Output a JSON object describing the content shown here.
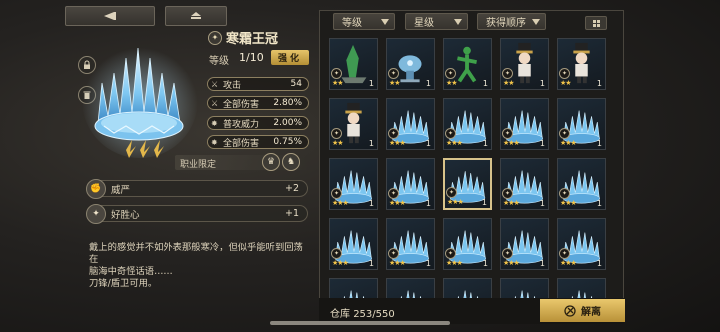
{
  "nav": {
    "back_icon": "back-arrow-icon",
    "menu_icon": "eject-menu-icon"
  },
  "item": {
    "name": "寒霜王冠",
    "level_label": "等级",
    "level_value": "1/10",
    "enhance_label": "强化",
    "stats": [
      {
        "icon": "sword-icon",
        "name": "攻击",
        "value": "54"
      },
      {
        "icon": "sword-icon",
        "name": "全部伤害",
        "value": "2.80%"
      },
      {
        "icon": "sparkle-icon",
        "name": "普攻威力",
        "value": "2.00%"
      },
      {
        "icon": "sparkle-icon",
        "name": "全部伤害",
        "value": "0.75%"
      }
    ],
    "job_label": "职业限定",
    "traits": [
      {
        "icon": "fist-icon",
        "name": "威严",
        "value": "+2"
      },
      {
        "icon": "stars-icon",
        "name": "好胜心",
        "value": "+1"
      }
    ],
    "description": [
      "戴上的感觉并不如外表那般寒冷，但似乎能听到回荡在",
      "脑海中奇怪话语……",
      "刀锋/盾卫可用。"
    ],
    "accent_color": "#d9b75a"
  },
  "inventory": {
    "filters": [
      {
        "label": "等级"
      },
      {
        "label": "星级"
      },
      {
        "label": "获得顺序"
      }
    ],
    "storage_label": "仓库",
    "storage_count": "253/550",
    "dismantle_label": "解离",
    "slots": [
      {
        "art": "green-statue",
        "stars": "★★",
        "count": "1"
      },
      {
        "art": "ice-drone",
        "stars": "★★",
        "count": "1"
      },
      {
        "art": "green-figure",
        "stars": "★★",
        "count": "1"
      },
      {
        "art": "nutcracker",
        "stars": "★★",
        "count": "1"
      },
      {
        "art": "nutcracker",
        "stars": "★★",
        "count": "1"
      },
      {
        "art": "nutcracker",
        "stars": "★★",
        "count": "1"
      },
      {
        "art": "ice-crown",
        "stars": "★★★",
        "count": "1"
      },
      {
        "art": "ice-crown",
        "stars": "★★★",
        "count": "1"
      },
      {
        "art": "ice-crown",
        "stars": "★★★",
        "count": "1"
      },
      {
        "art": "ice-crown",
        "stars": "★★★",
        "count": "1"
      },
      {
        "art": "ice-crown",
        "stars": "★★★",
        "count": "1"
      },
      {
        "art": "ice-crown",
        "stars": "★★★",
        "count": "1"
      },
      {
        "art": "ice-crown",
        "stars": "★★★",
        "count": "1",
        "selected": true
      },
      {
        "art": "ice-crown",
        "stars": "★★★",
        "count": "1"
      },
      {
        "art": "ice-crown",
        "stars": "★★★",
        "count": "1"
      },
      {
        "art": "ice-crown",
        "stars": "★★★",
        "count": "1"
      },
      {
        "art": "ice-crown",
        "stars": "★★★",
        "count": "1"
      },
      {
        "art": "ice-crown",
        "stars": "★★★",
        "count": "1"
      },
      {
        "art": "ice-crown",
        "stars": "★★★",
        "count": "1"
      },
      {
        "art": "ice-crown",
        "stars": "★★★",
        "count": "1"
      },
      {
        "art": "ice-crown",
        "stars": "",
        "count": ""
      },
      {
        "art": "ice-crown",
        "stars": "",
        "count": ""
      },
      {
        "art": "ice-crown",
        "stars": "",
        "count": ""
      },
      {
        "art": "ice-crown",
        "stars": "",
        "count": ""
      },
      {
        "art": "ice-crown",
        "stars": "",
        "count": ""
      }
    ]
  }
}
